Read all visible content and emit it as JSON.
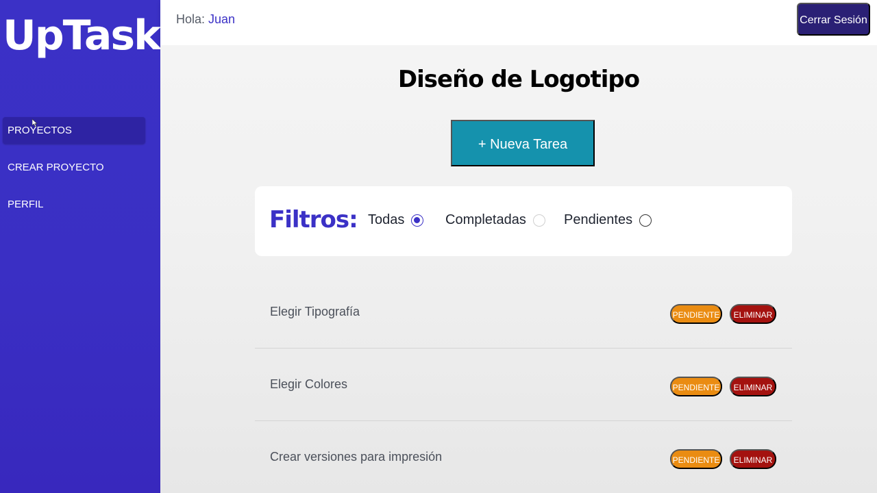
{
  "sidebar": {
    "brand": "UpTask",
    "items": [
      {
        "label": "PROYECTOS",
        "active": true
      },
      {
        "label": "CREAR PROYECTO",
        "active": false
      },
      {
        "label": "PERFIL",
        "active": false
      }
    ]
  },
  "header": {
    "greeting_prefix": "Hola: ",
    "user_name": "Juan",
    "logout_label": "Cerrar Sesión"
  },
  "main": {
    "project_title": "Diseño de Logotipo",
    "new_task_label": "+ Nueva Tarea",
    "filters": {
      "title": "Filtros:",
      "options": [
        {
          "label": "Todas",
          "selected": true
        },
        {
          "label": "Completadas",
          "selected": false
        },
        {
          "label": "Pendientes",
          "selected": false
        }
      ]
    },
    "tasks": [
      {
        "name": "Elegir Tipografía",
        "status_label": "PENDIENTE",
        "delete_label": "ELIMINAR"
      },
      {
        "name": "Elegir Colores",
        "status_label": "PENDIENTE",
        "delete_label": "ELIMINAR"
      },
      {
        "name": "Crear versiones para impresión",
        "status_label": "PENDIENTE",
        "delete_label": "ELIMINAR"
      }
    ]
  },
  "colors": {
    "brand_primary": "#3b31c6",
    "new_task_button": "#1592ad",
    "pending_badge": "#ea8c12",
    "delete_badge": "#a4120f",
    "logout_button": "#2a2075"
  }
}
